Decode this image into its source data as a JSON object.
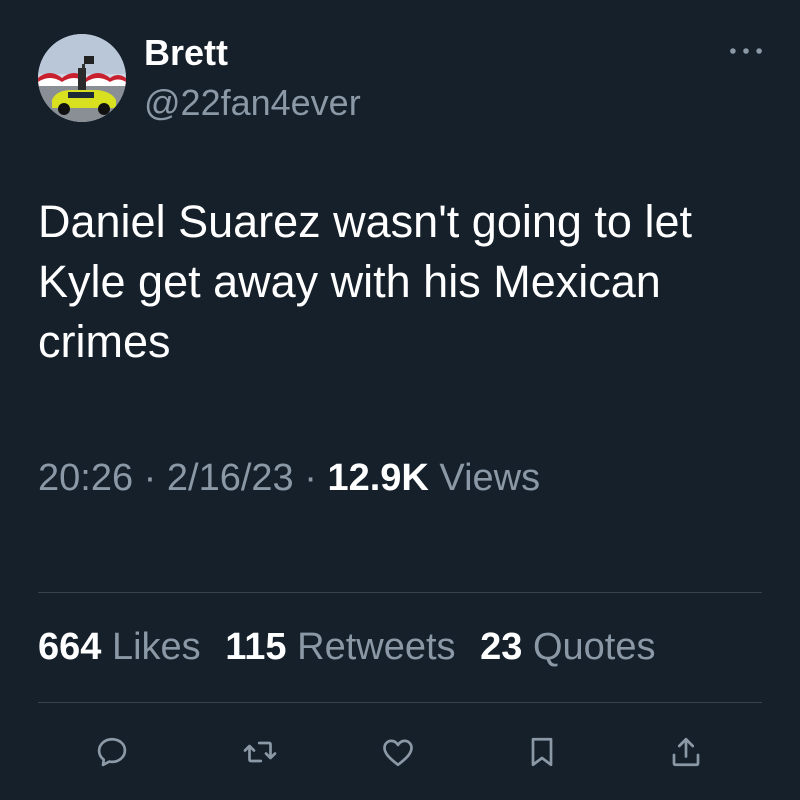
{
  "user": {
    "display_name": "Brett",
    "handle": "@22fan4ever",
    "avatar_icon": "race-car-avatar"
  },
  "more_icon": "more-dots-icon",
  "tweet": {
    "text": "Daniel Suarez wasn't going to let Kyle get away with his Mexican crimes"
  },
  "meta": {
    "time": "20:26",
    "separator": "·",
    "date": "2/16/23",
    "views_count": "12.9K",
    "views_label": "Views"
  },
  "stats": {
    "likes_count": "664",
    "likes_label": "Likes",
    "retweets_count": "115",
    "retweets_label": "Retweets",
    "quotes_count": "23",
    "quotes_label": "Quotes"
  },
  "actions": [
    {
      "name": "reply",
      "icon": "reply-icon"
    },
    {
      "name": "retweet",
      "icon": "retweet-icon"
    },
    {
      "name": "like",
      "icon": "heart-icon"
    },
    {
      "name": "bookmark",
      "icon": "bookmark-icon"
    },
    {
      "name": "share",
      "icon": "share-icon"
    }
  ],
  "colors": {
    "background": "#15202b",
    "text_primary": "#ffffff",
    "text_secondary": "#8b98a5",
    "divider": "#38444d"
  }
}
